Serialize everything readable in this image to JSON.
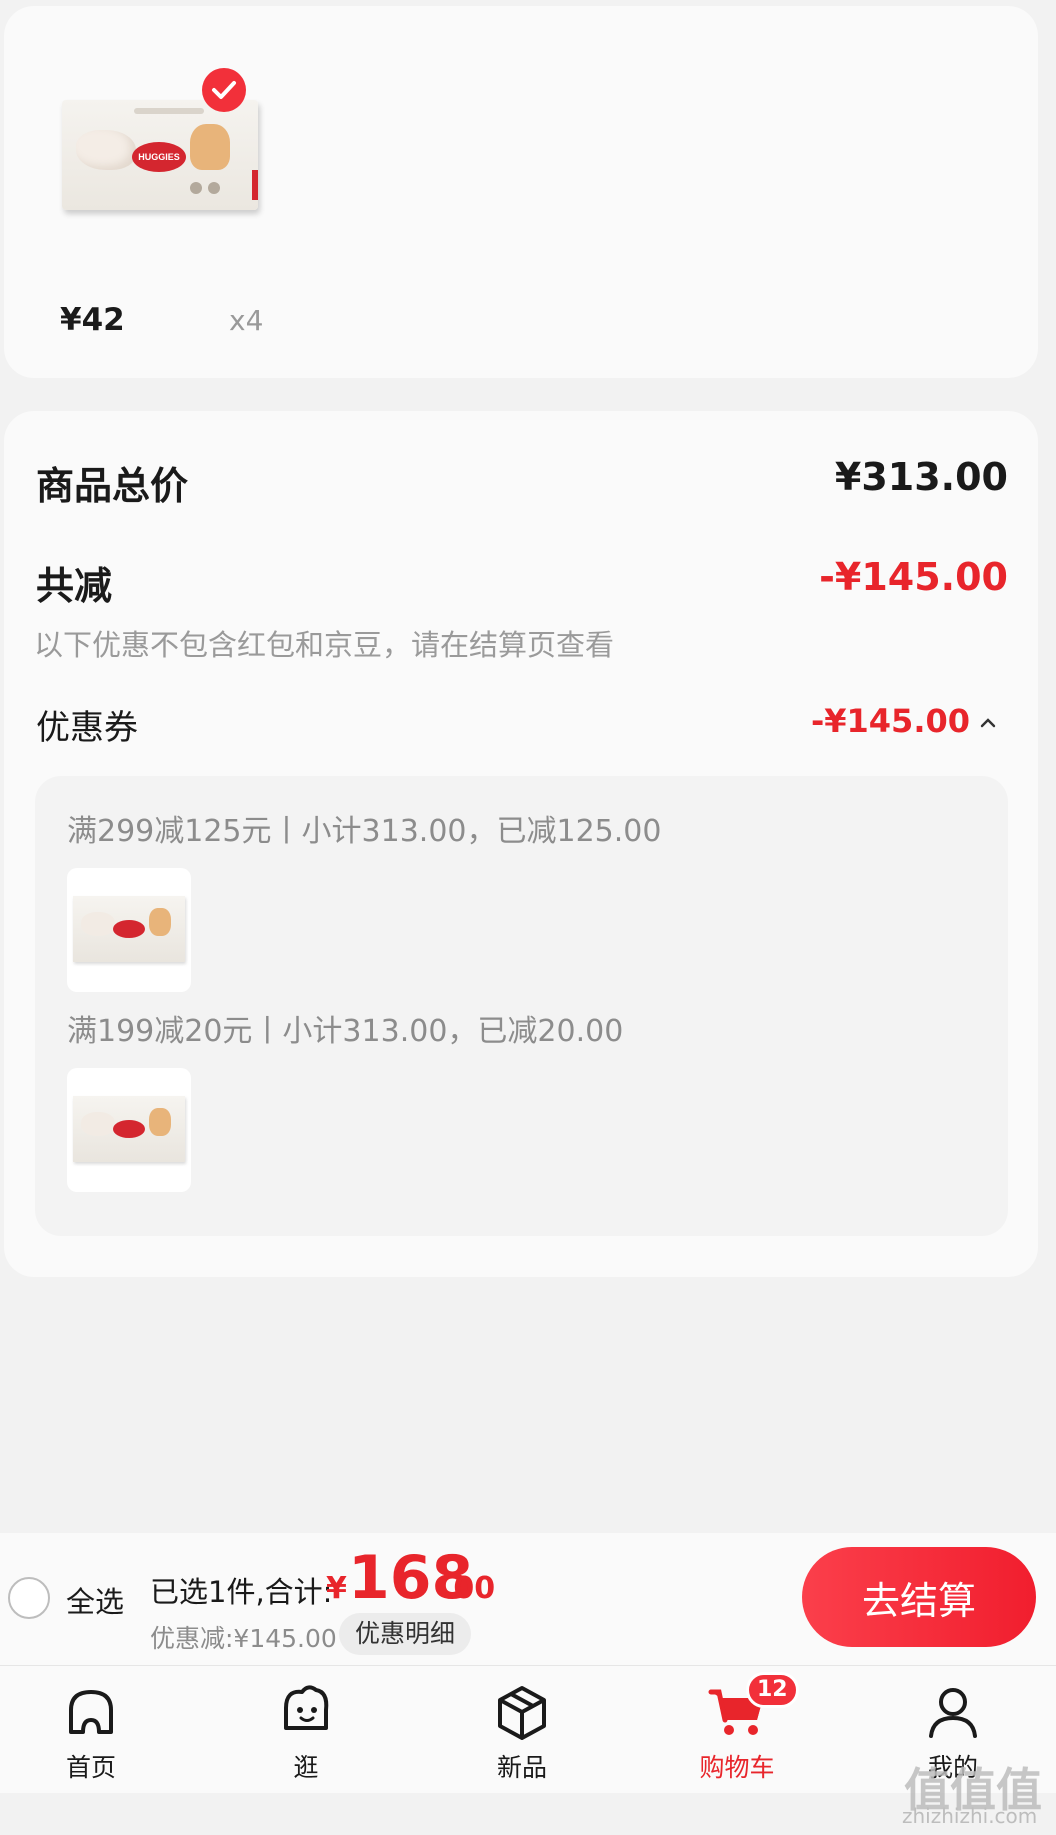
{
  "product": {
    "price": "¥42",
    "quantity": "x4",
    "logo_text": "HUGGIES"
  },
  "summary": {
    "goods_total_label": "商品总价",
    "goods_total_value": "¥313.00",
    "discount_label": "共减",
    "discount_value": "-¥145.00",
    "discount_note": "以下优惠不包含红包和京豆，请在结算页查看",
    "coupon_label": "优惠券",
    "coupon_value": "-¥145.00",
    "coupon_rules": [
      {
        "text": "满299减125元丨小计313.00，已减125.00"
      },
      {
        "text": "满199减20元丨小计313.00，已减20.00"
      }
    ]
  },
  "checkout_bar": {
    "select_all_label": "全选",
    "selected_text": "已选1件,合计:",
    "total_symbol": "¥",
    "total_integer": "168",
    "total_decimal": ".00",
    "discount_text": "优惠减:¥145.00",
    "detail_button": "优惠明细",
    "checkout_button": "去结算"
  },
  "tab_bar": {
    "tabs": [
      {
        "label": "首页",
        "icon": "home-icon"
      },
      {
        "label": "逛",
        "icon": "browse-face-icon"
      },
      {
        "label": "新品",
        "icon": "new-products-box-icon"
      },
      {
        "label": "购物车",
        "icon": "shopping-cart-icon",
        "badge": "12",
        "active": true
      },
      {
        "label": "我的",
        "icon": "user-profile-icon"
      }
    ]
  },
  "watermark": {
    "text": "值值值",
    "url": "zhizhizhi.com"
  },
  "colors": {
    "accent_red": "#e8252b",
    "checkout_gradient_start": "#fb3f4b",
    "checkout_gradient_end": "#f11e2e",
    "background": "#f2f2f2",
    "card": "#fafafa"
  }
}
